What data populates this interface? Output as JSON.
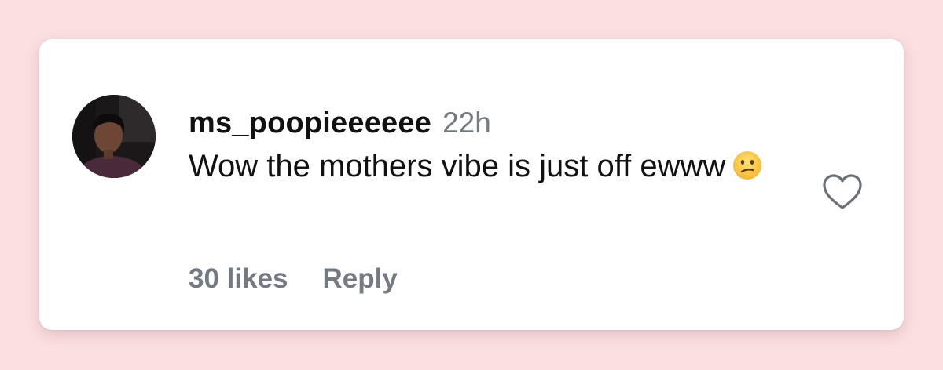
{
  "comment": {
    "username": "ms_poopieeeeee",
    "time": "22h",
    "text": "Wow the mothers vibe is just off ewww",
    "emoji": "confused-face-icon",
    "likes_label": "30 likes",
    "reply_label": "Reply"
  },
  "colors": {
    "page_background": "#fbdfe1",
    "card_background": "#ffffff",
    "username": "#111111",
    "meta_gray": "#737a84"
  }
}
